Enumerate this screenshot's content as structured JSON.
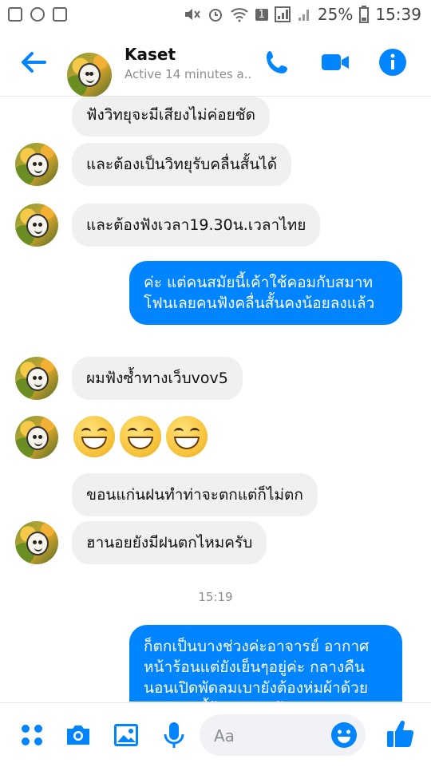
{
  "status_bar": {
    "battery_pct": "25%",
    "time": "15:39",
    "notif_count": "1"
  },
  "header": {
    "name": "Kaset",
    "status": "Active 14 minutes a..."
  },
  "messages": [
    {
      "dir": "in",
      "text": "ฟังวิทยุจะมีเสียงไม่ค่อยชัด"
    },
    {
      "dir": "in",
      "text": "และต้องเป็นวิทยุรับคลื่นสั้นได้"
    },
    {
      "dir": "in",
      "text": "และต้องฟังเวลา19.30น.เวลาไทย"
    },
    {
      "dir": "out",
      "text": "ค่ะ แต่คนสมัยนี้เค้าใช้คอมกับสมาทโฟนเลยคนฟังคลื่นสั้นคงน้อยลงแล้ว"
    },
    {
      "dir": "in",
      "text": "ผมฟังซ้ำทางเว็บvov5"
    },
    {
      "dir": "in",
      "text": "😄😄😄"
    },
    {
      "dir": "in",
      "text": "ขอนแก่นฝนทำท่าจะตกแต่ก็ไม่ตก"
    },
    {
      "dir": "in",
      "text": "ฮานอยยังมีฝนตกไหมครับ"
    },
    {
      "dir": "out",
      "text": "ก็ตกเป็นบางช่วงค่ะอาจารย์ อากาศหน้าร้อนแต่ยังเย็นๆอยู่ค่ะ กลางคืนนอนเปิดพัดลมเบายังต้องห่มผ้าด้วย ปกติช่วงนี้ร้อนมากแล้ว"
    }
  ],
  "timestamp": "15:19",
  "composer": {
    "placeholder": "Aa"
  },
  "colors": {
    "accent": "#0084ff",
    "incoming_bubble": "#f0f0f0"
  },
  "icons": [
    "back-arrow-icon",
    "phone-icon",
    "video-icon",
    "info-icon",
    "apps-icon",
    "camera-icon",
    "gallery-icon",
    "mic-icon",
    "emoji-icon",
    "like-icon"
  ]
}
